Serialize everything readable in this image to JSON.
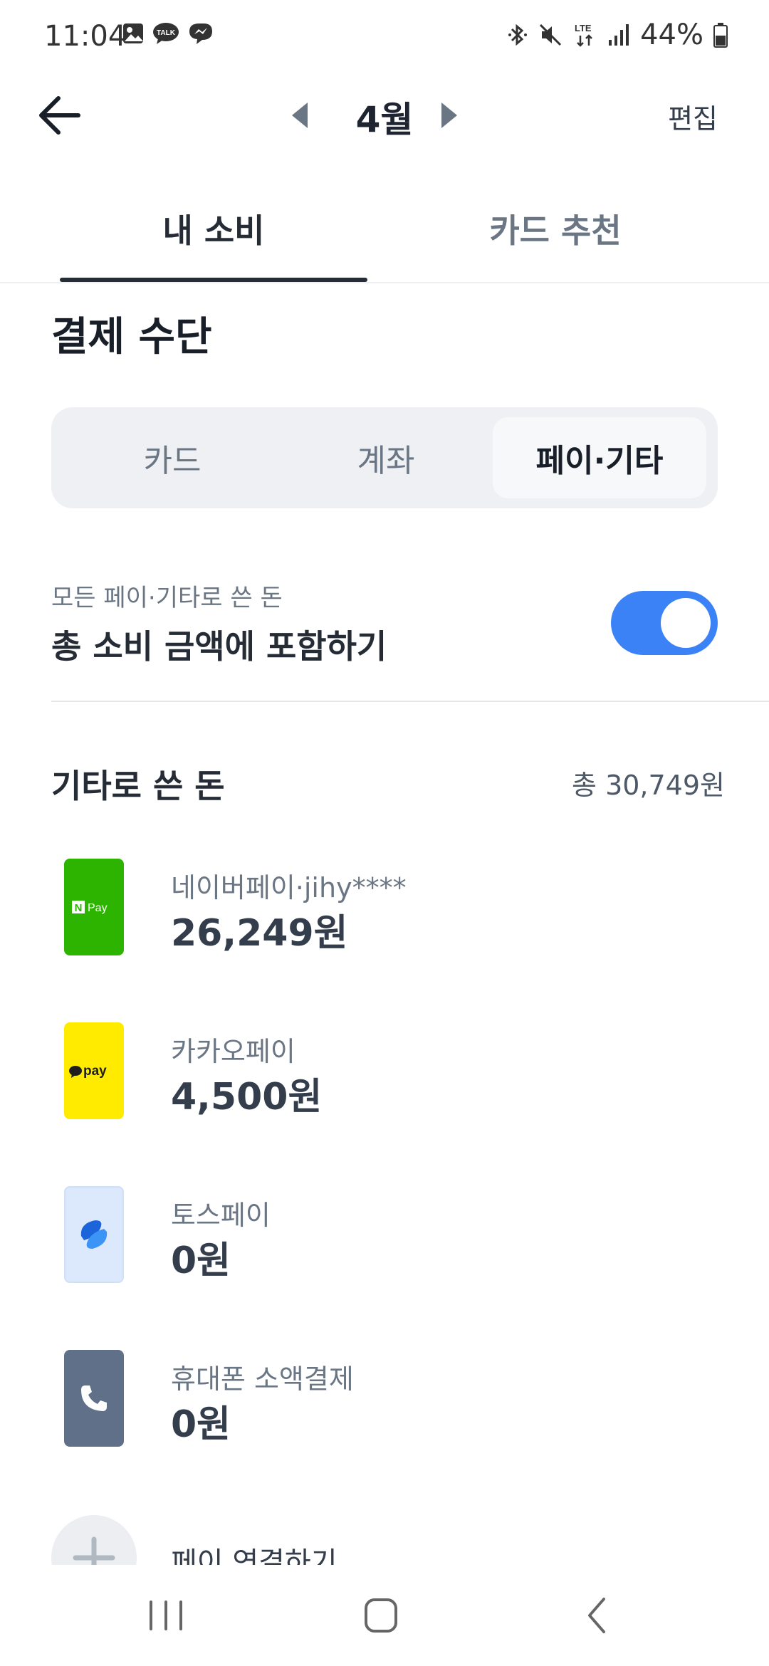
{
  "status_bar": {
    "time": "11:04",
    "battery": "44%",
    "network": "LTE",
    "left_icons": [
      "gallery-icon",
      "kakaotalk-icon",
      "messenger-icon"
    ],
    "right_icons": [
      "bluetooth-icon",
      "mute-icon",
      "lte-icon",
      "signal-icon",
      "battery-icon"
    ]
  },
  "header": {
    "month": "4월",
    "edit_label": "편집"
  },
  "tabs": [
    {
      "label": "내 소비",
      "active": true
    },
    {
      "label": "카드 추천",
      "active": false
    }
  ],
  "section": {
    "title": "결제 수단",
    "segments": [
      {
        "label": "카드",
        "active": false
      },
      {
        "label": "계좌",
        "active": false
      },
      {
        "label": "페이·기타",
        "active": true
      }
    ]
  },
  "include_toggle": {
    "caption": "모든 페이·기타로 쓴 돈",
    "title": "총 소비 금액에 포함하기",
    "on": true,
    "color": "#3b82f6"
  },
  "other": {
    "title": "기타로 쓴 돈",
    "total": "총 30,749원",
    "items": [
      {
        "name": "네이버페이·jihy****",
        "amount": "26,249원",
        "logo": "naverpay-logo",
        "logo_text": "Pay",
        "logo_badge": "N",
        "color": "#2db400"
      },
      {
        "name": "카카오페이",
        "amount": "4,500원",
        "logo": "kakaopay-logo",
        "logo_text": "pay",
        "color": "#ffeb00"
      },
      {
        "name": "토스페이",
        "amount": "0원",
        "logo": "tosspay-logo",
        "color": "#dce9fc"
      },
      {
        "name": "휴대폰 소액결제",
        "amount": "0원",
        "logo": "phone-icon",
        "color": "#5f7088"
      }
    ],
    "connect_label": "페이 연결하기"
  }
}
